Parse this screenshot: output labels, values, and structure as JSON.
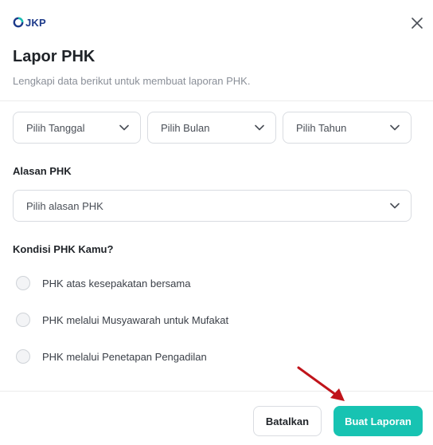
{
  "brand": {
    "logo_text": "JKP",
    "accent": "#17c3b2",
    "logo_color": "#1d3a8a"
  },
  "header": {
    "title": "Lapor PHK",
    "subtitle": "Lengkapi data berikut untuk membuat laporan PHK."
  },
  "date": {
    "day_placeholder": "Pilih Tanggal",
    "month_placeholder": "Pilih Bulan",
    "year_placeholder": "Pilih Tahun"
  },
  "reason": {
    "label": "Alasan PHK",
    "placeholder": "Pilih alasan PHK"
  },
  "condition": {
    "label": "Kondisi PHK Kamu?",
    "options": [
      "PHK atas kesepakatan bersama",
      "PHK melalui Musyawarah untuk Mufakat",
      "PHK melalui Penetapan Pengadilan"
    ]
  },
  "footer": {
    "cancel_label": "Batalkan",
    "submit_label": "Buat Laporan"
  },
  "annotation": {
    "arrow_color": "#c0141b"
  }
}
